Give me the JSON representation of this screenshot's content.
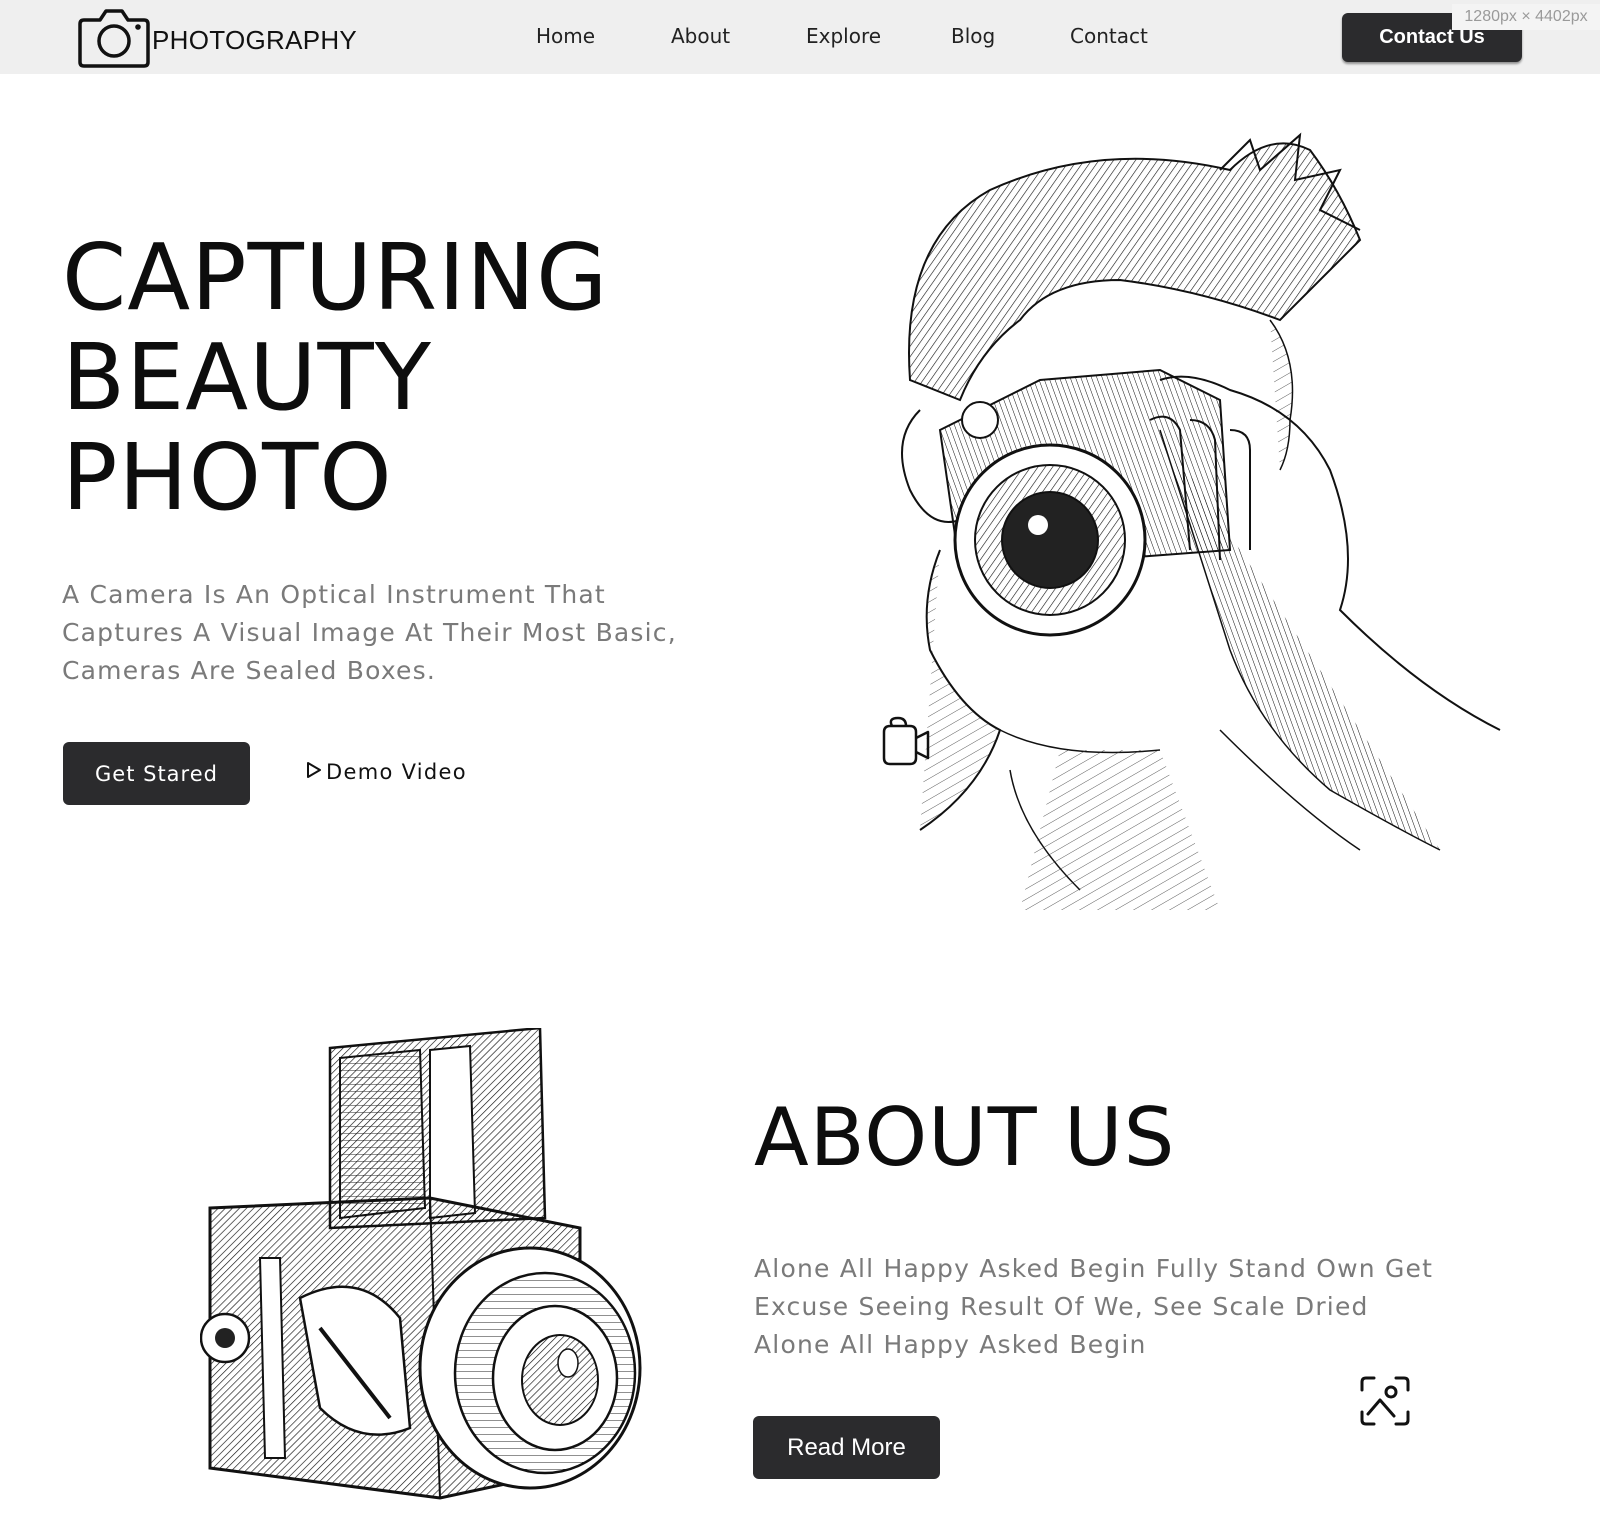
{
  "header": {
    "brand": "PHOTOGRAPHY",
    "nav": [
      {
        "label": "Home"
      },
      {
        "label": "About"
      },
      {
        "label": "Explore"
      },
      {
        "label": "Blog"
      },
      {
        "label": "Contact"
      }
    ],
    "cta_label": "Contact Us",
    "viewport_badge": "1280px × 4402px"
  },
  "hero": {
    "title_lines": [
      "CAPTURING",
      "BEAUTY",
      "PHOTO"
    ],
    "description": "A Camera Is An Optical Instrument That Captures A Visual Image At Their Most Basic, Cameras Are Sealed Boxes.",
    "primary_button": "Get Stared",
    "secondary_button": "Demo Video"
  },
  "about": {
    "title": "ABOUT US",
    "description": "Alone All Happy Asked Begin Fully Stand Own Get Excuse Seeing Result Of We, See Scale Dried Alone All Happy Asked Begin",
    "button": "Read More"
  },
  "icons": {
    "logo": "camera-icon",
    "play": "play-icon",
    "video": "video-camera-icon",
    "scan": "face-scan-icon"
  },
  "colors": {
    "header_bg": "#efefef",
    "button_bg": "#2b2b2d",
    "body_text": "#7a7a7a",
    "heading": "#0d0d0d"
  }
}
